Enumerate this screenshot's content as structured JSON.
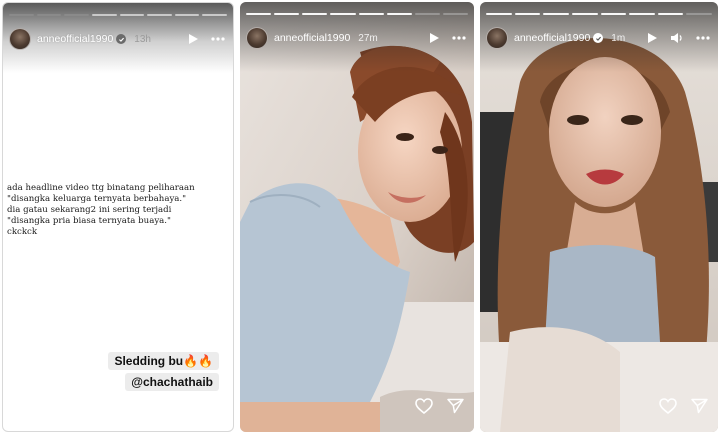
{
  "stories": [
    {
      "username": "anneofficial1990",
      "time": "13h",
      "caption_lines": [
        "ada headline video ttg binatang peliharaan",
        "  \"disangka keluarga ternyata berbahaya.\"",
        "dia gatau sekarang2 ini sering terjadi",
        "\"disangka pria biasa ternyata buaya.\"",
        "ckckck"
      ],
      "sticker_text": "Sledding bu🔥🔥",
      "mention": "@chachathaib"
    },
    {
      "username": "anneofficial1990",
      "time": "27m"
    },
    {
      "username": "anneofficial1990",
      "time": "1m"
    }
  ],
  "icons": {
    "verified": "verified-badge-icon",
    "play": "play-icon",
    "sound": "speaker-icon",
    "more": "more-icon",
    "like": "heart-icon",
    "share": "send-icon"
  }
}
